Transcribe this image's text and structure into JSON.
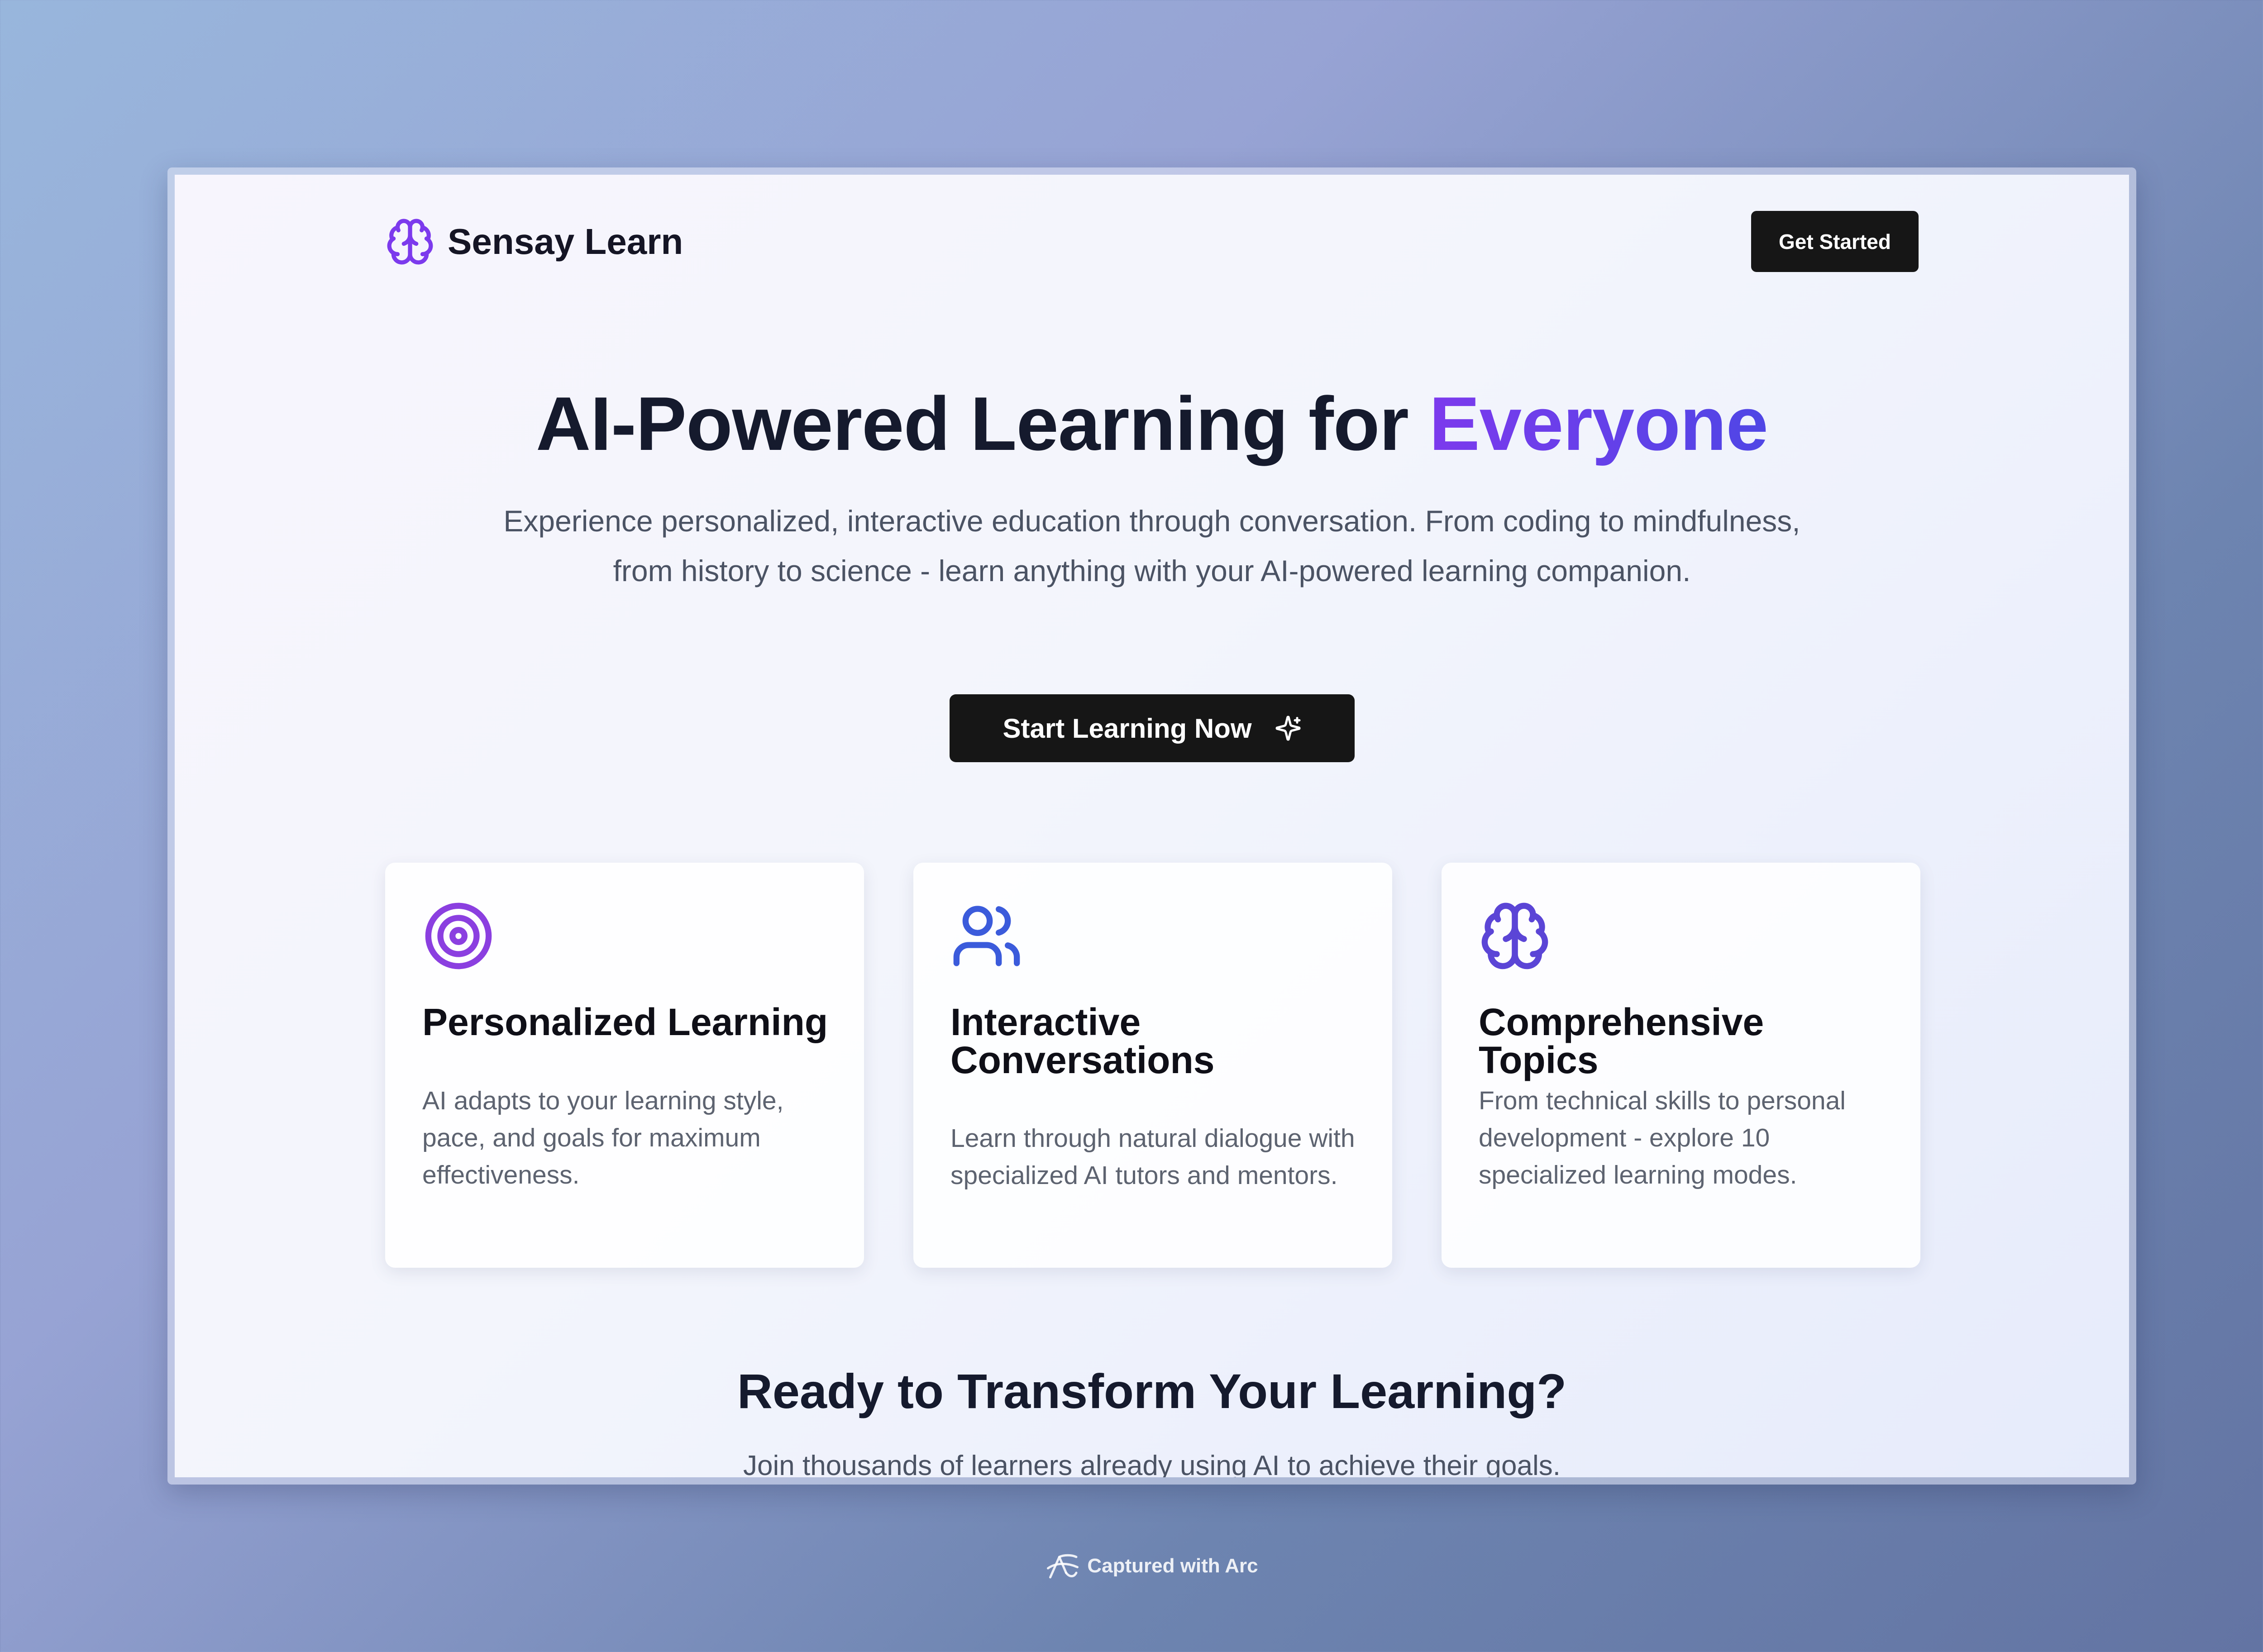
{
  "brand": {
    "name": "Sensay Learn",
    "icon": "brain-icon"
  },
  "nav": {
    "cta_label": "Get Started"
  },
  "hero": {
    "title_main": "AI-Powered Learning for",
    "title_accent": "Everyone",
    "subtitle": "Experience personalized, interactive education through conversation. From coding to mindfulness, from history to science - learn anything with your AI-powered learning companion.",
    "cta_label": "Start Learning Now",
    "cta_icon": "sparkles-icon"
  },
  "features": [
    {
      "icon": "target-icon",
      "title": "Personalized Learning",
      "description": "AI adapts to your learning style, pace, and goals for maximum effectiveness."
    },
    {
      "icon": "users-icon",
      "title": "Interactive Conversations",
      "description": "Learn through natural dialogue with specialized AI tutors and mentors."
    },
    {
      "icon": "brain-icon",
      "title": "Comprehensive Topics",
      "description": "From technical skills to personal development - explore 10 specialized learning modes."
    }
  ],
  "cta_section": {
    "title": "Ready to Transform Your Learning?",
    "subtitle": "Join thousands of learners already using AI to achieve their goals."
  },
  "footer": {
    "captured_label": "Captured with Arc",
    "icon": "arc-icon"
  },
  "colors": {
    "accent_purple": "#7c3aed",
    "accent_indigo": "#4f46e5",
    "accent_blue": "#3b5bdb",
    "button_dark": "#161616"
  }
}
